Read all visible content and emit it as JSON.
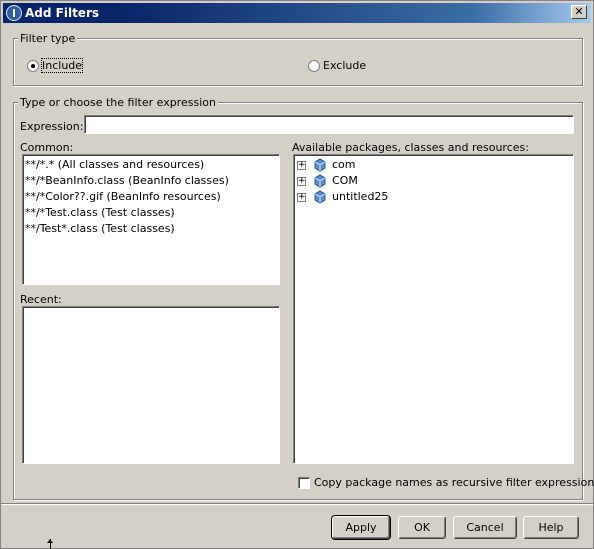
{
  "window": {
    "title": "Add Filters",
    "close_label": "✕"
  },
  "filter_type": {
    "legend": "Filter type",
    "include_label": "Include",
    "exclude_label": "Exclude",
    "selected": "Include"
  },
  "expression_group": {
    "legend": "Type or choose the filter expression",
    "expression_label": "Expression:",
    "expression_value": ""
  },
  "common": {
    "label": "Common:",
    "items": [
      "**/*.* (All classes and resources)",
      "**/*BeanInfo.class (BeanInfo classes)",
      "**/*Color??.gif (BeanInfo resources)",
      "**/*Test.class (Test classes)",
      "**/Test*.class (Test classes)"
    ]
  },
  "recent": {
    "label": "Recent:",
    "items": []
  },
  "available": {
    "label": "Available packages, classes and resources:",
    "items": [
      {
        "label": "com",
        "icon": "package-icon"
      },
      {
        "label": "COM",
        "icon": "package-icon"
      },
      {
        "label": "untitled25",
        "icon": "package-icon"
      }
    ]
  },
  "copy_checkbox": {
    "label": "Copy package names as recursive filter expressions",
    "checked": false
  },
  "buttons": {
    "apply": "Apply",
    "ok": "OK",
    "cancel": "Cancel",
    "help": "Help"
  }
}
